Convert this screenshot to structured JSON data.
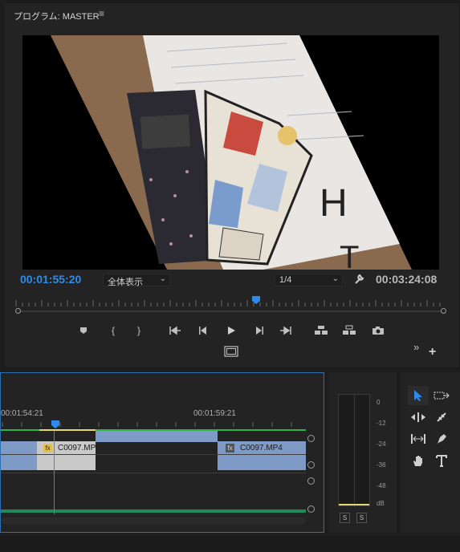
{
  "program_monitor": {
    "title": "プログラム: MASTER",
    "menu_icon": "hamburger-menu-icon",
    "current_timecode": "00:01:55:20",
    "fit_option": "全体表示",
    "resolution": "1/4",
    "duration_timecode": "00:03:24:08",
    "playhead_position": 0.56,
    "accent_color": "#2d8ceb"
  },
  "transport_icons": [
    "marker-icon",
    "mark-in-icon",
    "mark-out-icon",
    "go-to-in-icon",
    "step-back-icon",
    "play-icon",
    "step-forward-icon",
    "go-to-out-icon",
    "lift-icon",
    "extract-icon",
    "export-frame-icon",
    "safe-margins-icon",
    "more-icon",
    "add-button-icon"
  ],
  "timeline": {
    "timecode_left": "00:01:54:21",
    "timecode_right": "00:01:59:21",
    "clips": [
      {
        "name": "C0097.MP"
      },
      {
        "name": "C0097.MP4"
      }
    ],
    "fx_badge": "fx",
    "clip_color": "#7e9bc8"
  },
  "audio_meter": {
    "scale": [
      "0",
      "-12",
      "-24",
      "-36",
      "-48",
      "dB"
    ],
    "solo_labels": [
      "S",
      "S"
    ]
  },
  "tools": [
    "selection-tool-icon",
    "track-select-forward-icon",
    "ripple-edit-icon",
    "razor-icon",
    "slip-icon",
    "pen-icon",
    "hand-icon",
    "type-icon"
  ]
}
